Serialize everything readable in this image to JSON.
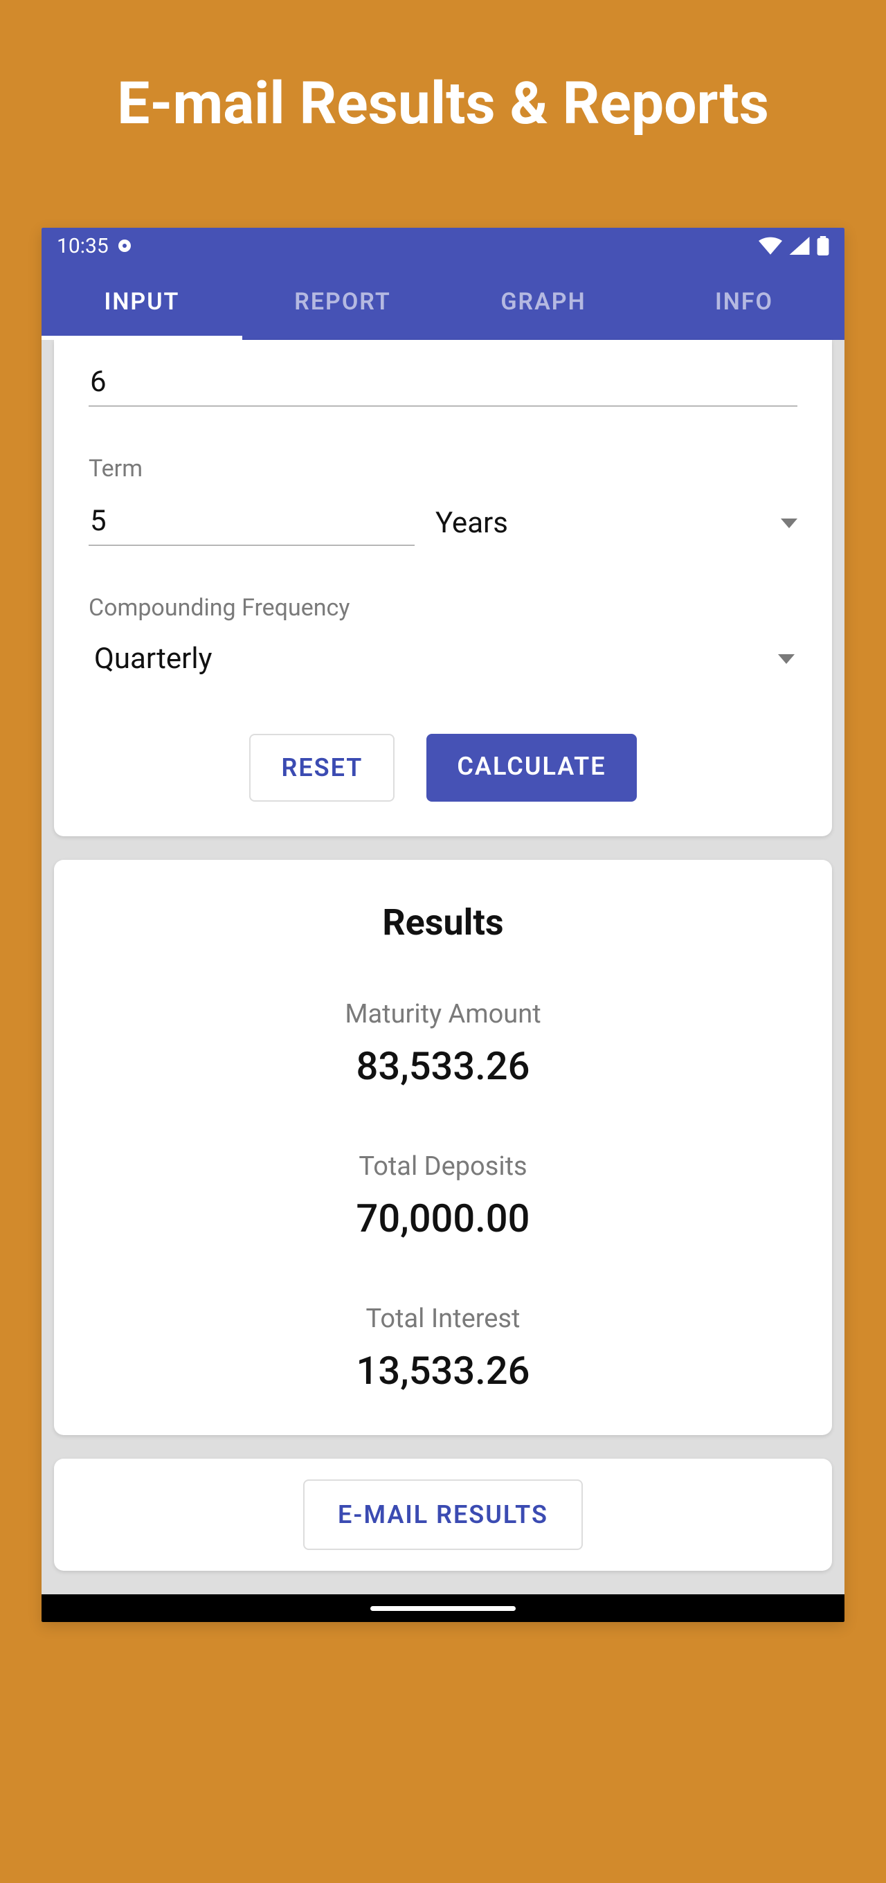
{
  "page_title": "E-mail Results & Reports",
  "statusbar": {
    "time": "10:35"
  },
  "tabs": [
    {
      "label": "INPUT",
      "active": true
    },
    {
      "label": "REPORT",
      "active": false
    },
    {
      "label": "GRAPH",
      "active": false
    },
    {
      "label": "INFO",
      "active": false
    }
  ],
  "inputs": {
    "rate_value": "6",
    "term_label": "Term",
    "term_value": "5",
    "term_unit": "Years",
    "compounding_label": "Compounding Frequency",
    "compounding_value": "Quarterly"
  },
  "buttons": {
    "reset": "RESET",
    "calculate": "CALCULATE",
    "email": "E-MAIL RESULTS"
  },
  "results": {
    "title": "Results",
    "maturity_label": "Maturity Amount",
    "maturity_value": "83,533.26",
    "deposits_label": "Total Deposits",
    "deposits_value": "70,000.00",
    "interest_label": "Total Interest",
    "interest_value": "13,533.26"
  }
}
